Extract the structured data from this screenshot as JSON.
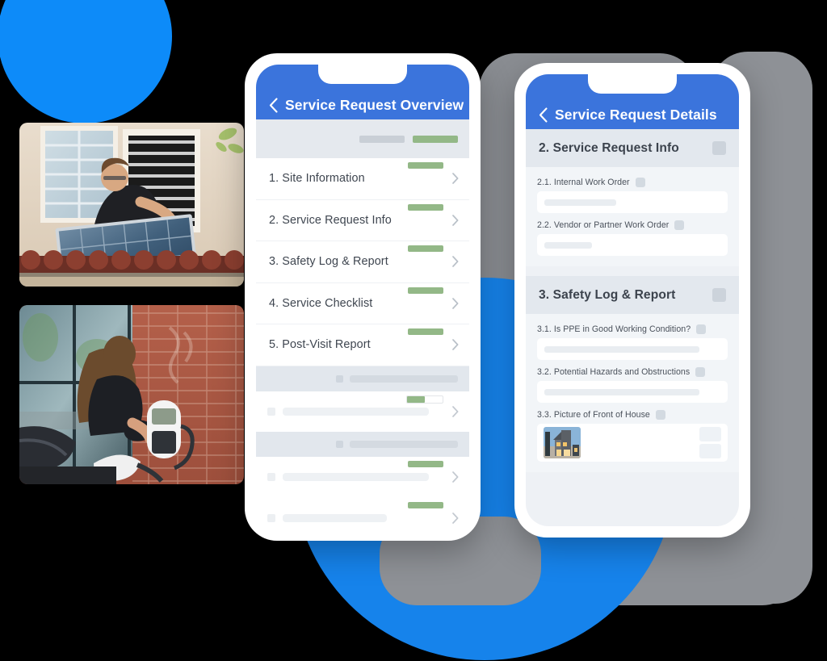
{
  "background": {
    "accent_blue": "#0d8bf9",
    "circle_blue": "#1683eb",
    "canvas": "#000000"
  },
  "photos": [
    {
      "name": "solar-panel-installation-photo",
      "alt": "Technician installing a solar panel on a tiled roof beside a window"
    },
    {
      "name": "ev-charger-photo",
      "alt": "Woman using a wall-mounted EV charger on a brick wall"
    }
  ],
  "phone_left": {
    "header": {
      "back_icon": "chevron-left-icon",
      "title": "Service Request Overview",
      "bg": "#3b74dc"
    },
    "progress_strip": {
      "grey_pill": "",
      "green_pill": ""
    },
    "sections": [
      {
        "label": "1. Site Information",
        "badge": "full",
        "chevron": "chevron-right-icon"
      },
      {
        "label": "2. Service Request Info",
        "badge": "full",
        "chevron": "chevron-right-icon"
      },
      {
        "label": "3. Safety Log & Report",
        "badge": "full",
        "chevron": "chevron-right-icon"
      },
      {
        "label": "4. Service Checklist",
        "badge": "full",
        "chevron": "chevron-right-icon"
      },
      {
        "label": "5. Post-Visit Report",
        "badge": "full",
        "chevron": "chevron-right-icon"
      }
    ],
    "skeleton_groups": [
      {
        "type": "group-header"
      },
      {
        "type": "row",
        "badge": "half"
      },
      {
        "type": "group-header"
      },
      {
        "type": "row",
        "badge": "full"
      },
      {
        "type": "row",
        "badge": "full"
      }
    ],
    "badge_color": "#93b887"
  },
  "phone_right": {
    "header": {
      "back_icon": "chevron-left-icon",
      "title": "Service Request Details",
      "bg": "#3b74dc"
    },
    "sections": [
      {
        "title": "2. Service Request Info",
        "fields": [
          {
            "label": "2.1. Internal Work Order",
            "type": "text",
            "value": ""
          },
          {
            "label": "2.2. Vendor or Partner Work Order",
            "type": "text",
            "value": ""
          }
        ]
      },
      {
        "title": "3. Safety Log & Report",
        "fields": [
          {
            "label": "3.1. Is PPE in Good Working Condition?",
            "type": "text",
            "value": ""
          },
          {
            "label": "3.2. Potential Hazards and Obstructions",
            "type": "text",
            "value": ""
          },
          {
            "label": "3.3. Picture of Front of House",
            "type": "photo",
            "value": "house-thumbnail"
          }
        ]
      }
    ]
  }
}
